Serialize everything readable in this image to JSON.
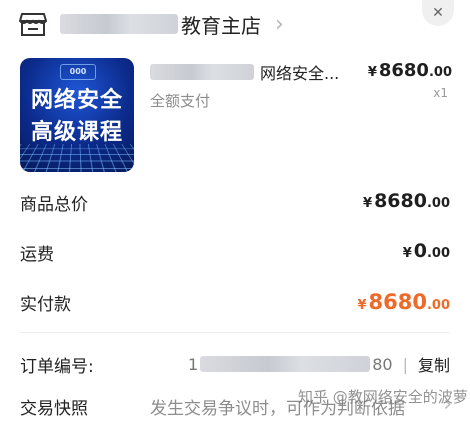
{
  "header": {
    "shop_name_suffix": "教育主店",
    "chevron": "›",
    "close": "✕"
  },
  "product": {
    "thumbnail_line1": "网络安全",
    "thumbnail_line2": "高级课程",
    "thumbnail_chip": "000",
    "title_suffix": "网络安全...",
    "subtitle": "全额支付",
    "price_currency": "¥",
    "price_int": "8680",
    "price_dec": ".00",
    "quantity": "x1"
  },
  "summary": {
    "total_label": "商品总价",
    "total_int": "8680",
    "total_dec": ".00",
    "shipping_label": "运费",
    "shipping_int": "0",
    "shipping_dec": ".00",
    "paid_label": "实付款",
    "paid_int": "8680",
    "paid_dec": ".00",
    "currency": "¥"
  },
  "order": {
    "number_label": "订单编号:",
    "number_prefix": "1",
    "number_suffix": "80",
    "separator": "|",
    "copy_label": "复制",
    "snapshot_label": "交易快照",
    "snapshot_text": "发生交易争议时，可作为判断依据",
    "snapshot_chevron": "›"
  },
  "watermark": "知乎 @教网络安全的波萝",
  "colors": {
    "accent_orange": "#ee6a28",
    "text_primary": "#1f1f1f",
    "text_secondary": "#8d8d8d"
  }
}
